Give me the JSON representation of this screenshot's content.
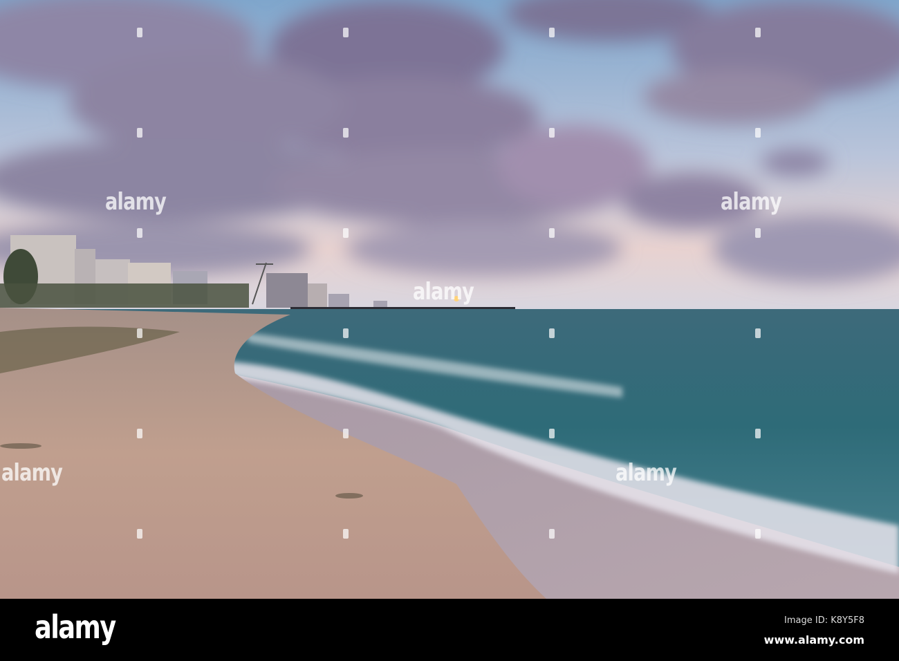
{
  "watermark": {
    "text": "alamy"
  },
  "footer": {
    "logo": "alamy",
    "image_id": "Image ID: K8Y5F8",
    "website": "www.alamy.com"
  },
  "colors": {
    "sky": "#8fb4d6",
    "cloud": "#8a7f9e",
    "sea": "#2e6b78",
    "sand": "#b89a8a",
    "bar": "#000000"
  }
}
